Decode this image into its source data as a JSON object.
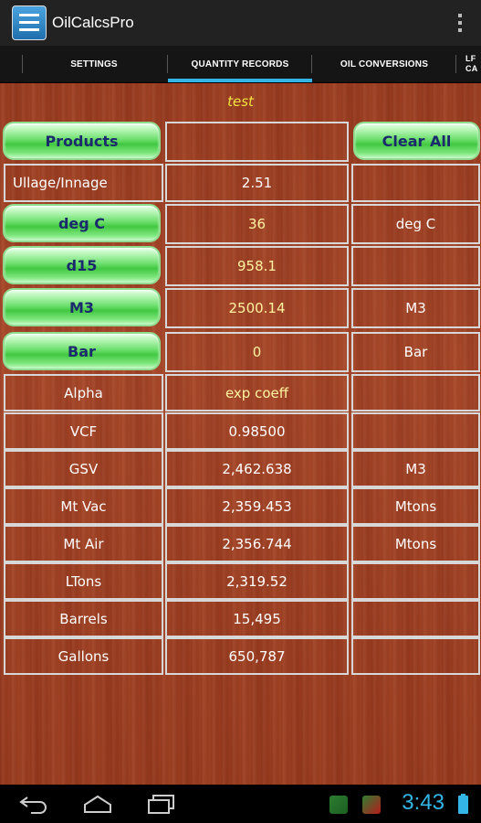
{
  "app": {
    "title": "OilCalcsPro"
  },
  "tabs": [
    {
      "label": "SETTINGS"
    },
    {
      "label": "QUANTITY RECORDS"
    },
    {
      "label": "OIL CONVERSIONS"
    },
    {
      "label": "LF\nCA"
    }
  ],
  "record": {
    "name": "test"
  },
  "grid": {
    "products_button": "Products",
    "clear_all_button": "Clear All",
    "rows": [
      {
        "label": "Ullage/Innage",
        "value": "2.51",
        "unit": ""
      },
      {
        "label": "deg C",
        "value": "36",
        "unit": "deg C"
      },
      {
        "label": "d15",
        "value": "958.1",
        "unit": ""
      },
      {
        "label": "M3",
        "value": "2500.14",
        "unit": "M3"
      },
      {
        "label": "Bar",
        "value": "0",
        "unit": "Bar"
      },
      {
        "label": "Alpha",
        "value": "exp coeff",
        "unit": ""
      },
      {
        "label": "VCF",
        "value": "0.98500",
        "unit": ""
      },
      {
        "label": "GSV",
        "value": "2,462.638",
        "unit": "M3"
      },
      {
        "label": "Mt Vac",
        "value": "2,359.453",
        "unit": "Mtons"
      },
      {
        "label": "Mt Air",
        "value": "2,356.744",
        "unit": "Mtons"
      },
      {
        "label": "LTons",
        "value": "2,319.52",
        "unit": ""
      },
      {
        "label": "Barrels",
        "value": "15,495",
        "unit": ""
      },
      {
        "label": "Gallons",
        "value": "650,787",
        "unit": ""
      }
    ]
  },
  "status": {
    "time": "3:43"
  },
  "icons": {
    "app": "oilcalcs-app-icon",
    "overflow": "overflow-menu-icon",
    "back": "back-icon",
    "home": "home-icon",
    "recent": "recent-apps-icon",
    "notif1": "cube-notification-icon",
    "notif2": "cube-notification-icon",
    "battery": "battery-icon"
  }
}
